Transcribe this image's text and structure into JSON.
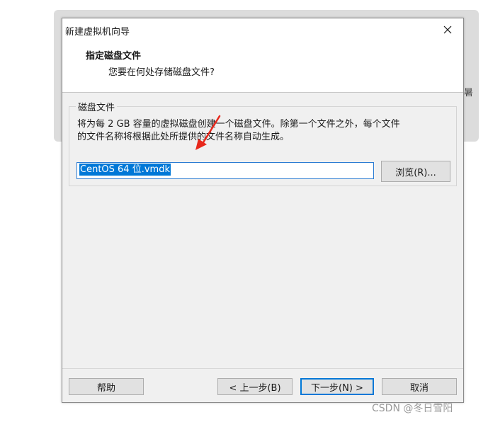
{
  "window": {
    "title": "新建虚拟机向导"
  },
  "header": {
    "title": "指定磁盘文件",
    "subtitle": "您要在何处存储磁盘文件?"
  },
  "disk_group": {
    "legend": "磁盘文件",
    "description_line1": "将为每 2 GB 容量的虚拟磁盘创建一个磁盘文件。除第一个文件之外，每个文件",
    "description_line2": "的文件名称将根据此处所提供的文件名称自动生成。",
    "file_name_value": "CentOS 64 位.vmdk",
    "browse_label": "浏览(R)..."
  },
  "footer": {
    "help_label": "帮助",
    "back_label": "< 上一步(B)",
    "next_label": "下一步(N) >",
    "cancel_label": "取消"
  },
  "watermark": "CSDN @冬日雪阳",
  "background_edge_text": "暑",
  "colors": {
    "accent": "#0078d7",
    "annotation_arrow": "#e8281c"
  }
}
